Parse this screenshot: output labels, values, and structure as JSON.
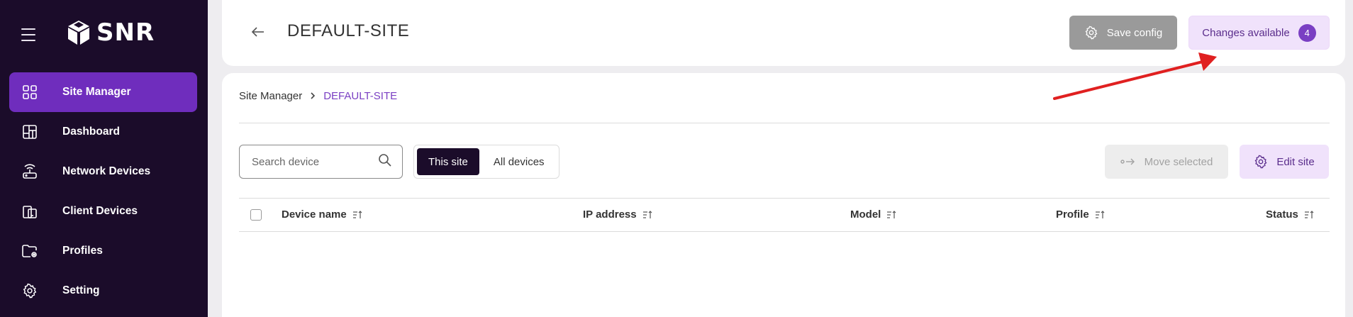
{
  "brand": {
    "name": "SNR"
  },
  "sidebar": {
    "items": [
      {
        "label": "Site Manager",
        "icon": "grid-icon",
        "active": true
      },
      {
        "label": "Dashboard",
        "icon": "dashboard-icon",
        "active": false
      },
      {
        "label": "Network Devices",
        "icon": "router-icon",
        "active": false
      },
      {
        "label": "Client Devices",
        "icon": "devices-icon",
        "active": false
      },
      {
        "label": "Profiles",
        "icon": "folder-gear-icon",
        "active": false
      },
      {
        "label": "Setting",
        "icon": "gear-icon",
        "active": false
      }
    ]
  },
  "header": {
    "title": "DEFAULT-SITE",
    "save_label": "Save config",
    "changes_label": "Changes available",
    "changes_count": "4"
  },
  "breadcrumb": {
    "root": "Site Manager",
    "current": "DEFAULT-SITE"
  },
  "toolbar": {
    "search_placeholder": "Search device",
    "segments": [
      "This site",
      "All devices"
    ],
    "active_segment": "This site",
    "move_label": "Move selected",
    "edit_label": "Edit site"
  },
  "table": {
    "columns": [
      "Device name",
      "IP address",
      "Model",
      "Profile",
      "Status"
    ],
    "rows": []
  },
  "colors": {
    "sidebar_bg": "#1b0c2a",
    "accent": "#6f2dbd",
    "accent_light": "#f0e2fb",
    "annotation_arrow": "#e02020"
  }
}
